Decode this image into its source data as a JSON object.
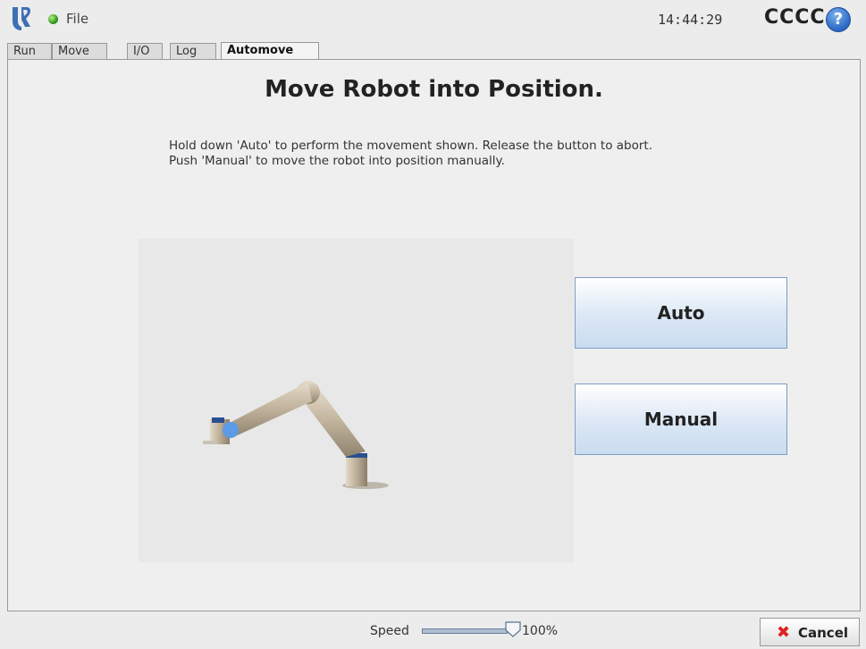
{
  "header": {
    "file_label": "File",
    "clock": "14:44:29",
    "robot_name": "CCCC",
    "help_symbol": "?"
  },
  "tabs": [
    {
      "label": "Run"
    },
    {
      "label": "Move"
    },
    {
      "label": "I/O"
    },
    {
      "label": "Log"
    },
    {
      "label": "Automove",
      "active": true
    }
  ],
  "main": {
    "title": "Move Robot into Position.",
    "instruction_line1": "Hold down 'Auto' to perform the movement shown. Release the button to abort.",
    "instruction_line2": "Push 'Manual' to move the robot into position manually.",
    "auto_label": "Auto",
    "manual_label": "Manual"
  },
  "footer": {
    "speed_label": "Speed",
    "speed_value": "100%",
    "speed_fraction": 1.0,
    "cancel_label": "Cancel"
  },
  "icons": {
    "logo": "universal-robots-logo",
    "status": "green-status-dot",
    "help": "help-question-icon",
    "cancel": "red-x-icon"
  },
  "colors": {
    "button_gradient_bottom": "#c9dcef",
    "status_green": "#2f9a1a",
    "help_blue": "#2c67c4",
    "cancel_red": "#dd2222"
  }
}
